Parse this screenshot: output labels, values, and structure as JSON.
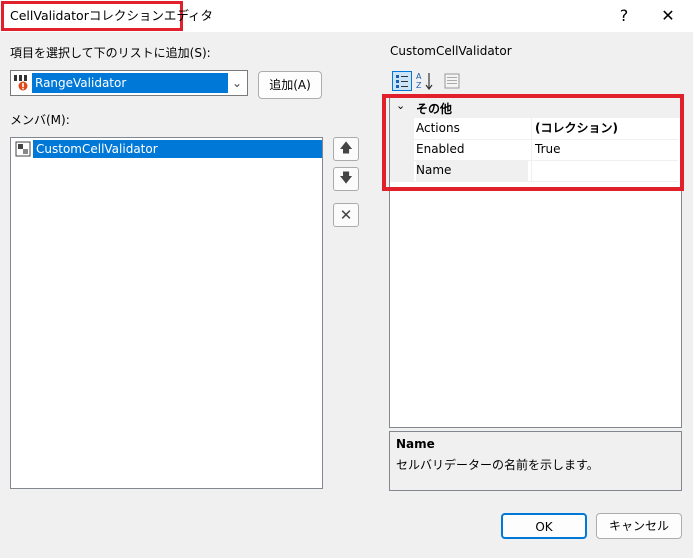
{
  "window": {
    "title": "CellValidatorコレクションエディタ",
    "help_label": "?",
    "close_label": "✕"
  },
  "left": {
    "add_label": "項目を選択して下のリストに追加(S):",
    "combo_value": "RangeValidator",
    "add_button": "追加(A)",
    "members_label": "メンバ(M):",
    "members": [
      "CustomCellValidator"
    ]
  },
  "right": {
    "object_name": "CustomCellValidator",
    "toolbar_icons": [
      "categorized-icon",
      "alphabetical-icon",
      "property-pages-icon"
    ],
    "category": "その他",
    "properties": [
      {
        "name": "Actions",
        "value": "(コレクション)",
        "bold": true
      },
      {
        "name": "Enabled",
        "value": "True",
        "bold": false
      },
      {
        "name": "Name",
        "value": "",
        "bold": false
      }
    ],
    "description_title": "Name",
    "description_text": "セルバリデーターの名前を示します。"
  },
  "buttons": {
    "ok": "OK",
    "cancel": "キャンセル"
  },
  "colors": {
    "highlight": "#e0202a",
    "selection": "#0078d7"
  }
}
